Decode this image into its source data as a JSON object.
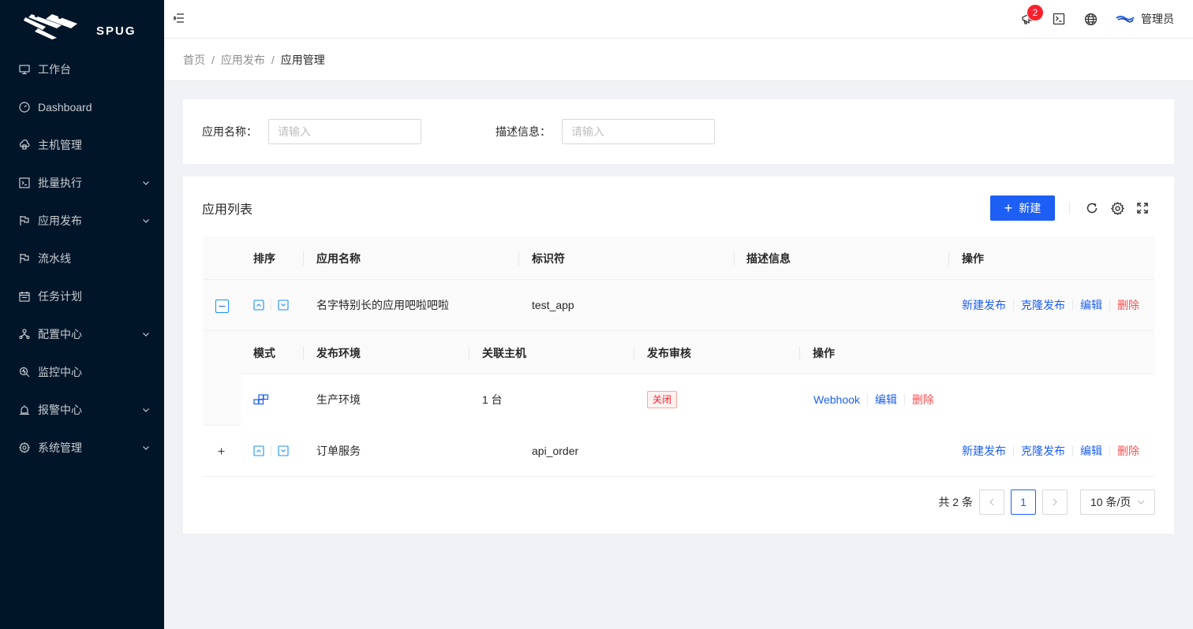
{
  "brand": {
    "name": "SPUG"
  },
  "sidebar": {
    "items": [
      {
        "label": "工作台",
        "icon": "desktop-icon",
        "has_children": false
      },
      {
        "label": "Dashboard",
        "icon": "dashboard-icon",
        "has_children": false
      },
      {
        "label": "主机管理",
        "icon": "cloud-server-icon",
        "has_children": false
      },
      {
        "label": "批量执行",
        "icon": "code-icon",
        "has_children": true
      },
      {
        "label": "应用发布",
        "icon": "flag-icon",
        "has_children": true
      },
      {
        "label": "流水线",
        "icon": "pipeline-icon",
        "has_children": false
      },
      {
        "label": "任务计划",
        "icon": "schedule-icon",
        "has_children": false
      },
      {
        "label": "配置中心",
        "icon": "deployment-icon",
        "has_children": true
      },
      {
        "label": "监控中心",
        "icon": "monitor-icon",
        "has_children": false
      },
      {
        "label": "报警中心",
        "icon": "alert-icon",
        "has_children": true
      },
      {
        "label": "系统管理",
        "icon": "setting-icon",
        "has_children": true
      }
    ]
  },
  "header": {
    "notification_count": "2",
    "user_name": "管理员"
  },
  "breadcrumb": [
    "首页",
    "应用发布",
    "应用管理"
  ],
  "search": {
    "name_label": "应用名称：",
    "name_placeholder": "请输入",
    "desc_label": "描述信息：",
    "desc_placeholder": "请输入"
  },
  "table": {
    "title": "应用列表",
    "new_button": "新建",
    "columns": [
      "排序",
      "应用名称",
      "标识符",
      "描述信息",
      "操作"
    ],
    "rows": [
      {
        "name": "名字特别长的应用吧啦吧啦",
        "key": "test_app",
        "desc": "",
        "expanded": true
      },
      {
        "name": "订单服务",
        "key": "api_order",
        "desc": "",
        "expanded": false
      }
    ],
    "row_actions": [
      "新建发布",
      "克隆发布",
      "编辑",
      "删除"
    ],
    "sub": {
      "columns": [
        "模式",
        "发布环境",
        "关联主机",
        "发布审核",
        "操作"
      ],
      "rows": [
        {
          "mode_icon": "build-icon",
          "env": "生产环境",
          "hosts": "1 台",
          "review": "关闭",
          "actions": [
            "Webhook",
            "编辑",
            "删除"
          ]
        }
      ]
    }
  },
  "pagination": {
    "total": "共 2 条",
    "current": "1",
    "page_size": "10 条/页"
  },
  "colors": {
    "primary": "#1d5ff5",
    "danger": "#ff4d4f",
    "sidebar_bg": "#011529"
  }
}
